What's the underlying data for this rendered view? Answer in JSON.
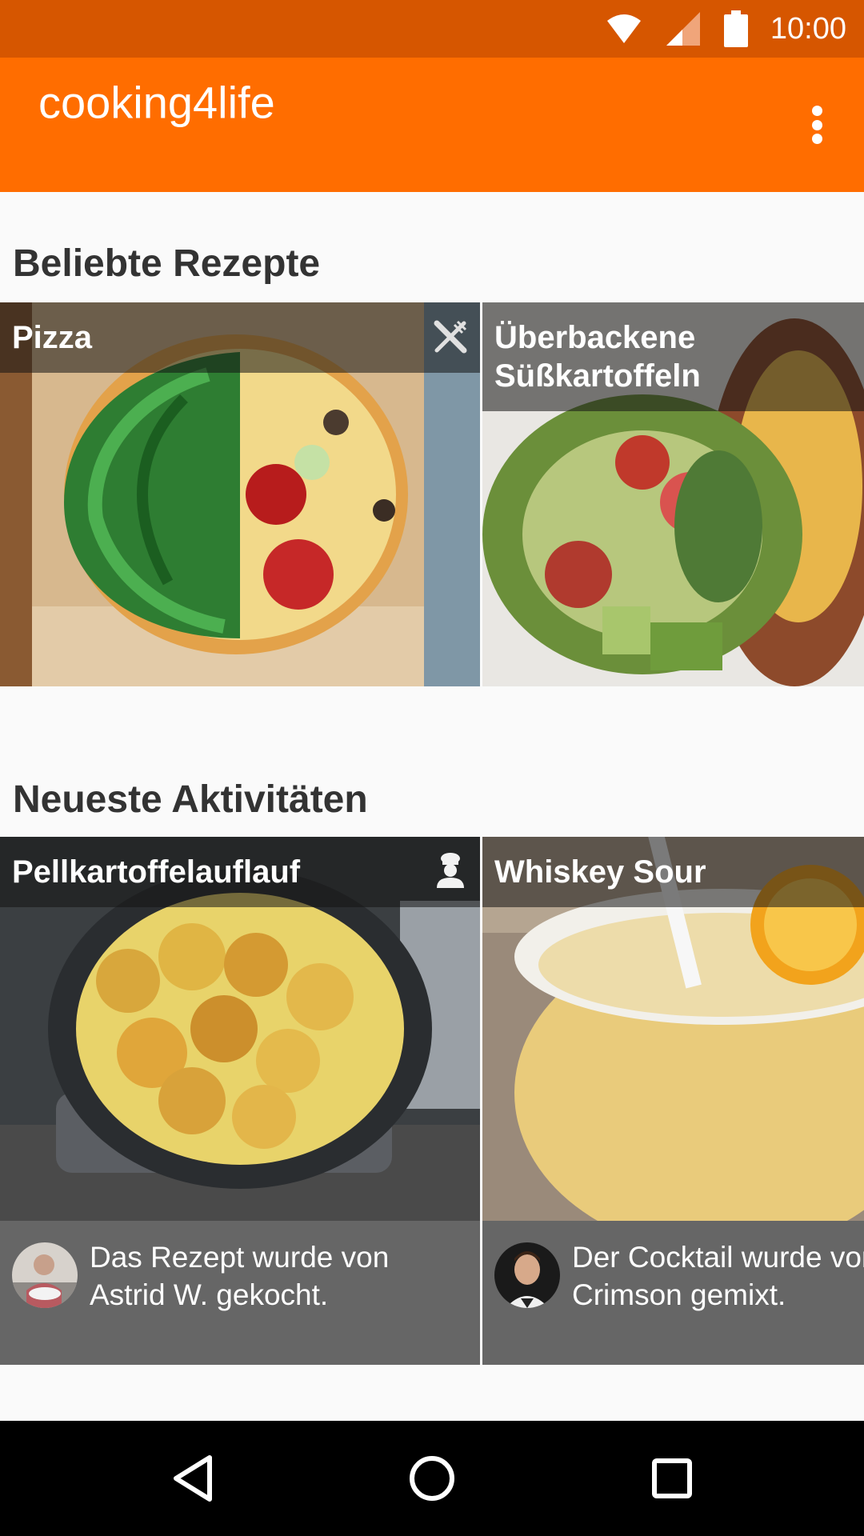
{
  "status_bar": {
    "time": "10:00",
    "icons": [
      "wifi-icon",
      "signal-icon",
      "battery-icon"
    ]
  },
  "app_bar": {
    "title": "cooking4life",
    "menu_icon": "more-vert-icon"
  },
  "sections": {
    "popular": {
      "title": "Beliebte Rezepte",
      "cards": [
        {
          "title": "Pizza",
          "badge_icon": "cutlery-icon"
        },
        {
          "title": "Überbackene Süßkartoffeln"
        }
      ]
    },
    "recent": {
      "title": "Neueste Aktivitäten",
      "cards": [
        {
          "title": "Pellkartoffelauflauf",
          "badge_icon": "chef-icon",
          "activity": "Das Rezept wurde von Astrid W. gekocht."
        },
        {
          "title": "Whiskey Sour",
          "activity": "Der Cocktail wurde von Crimson gemixt."
        }
      ]
    }
  },
  "nav_bar": {
    "icons": [
      "back-icon",
      "home-icon",
      "recents-icon"
    ]
  },
  "colors": {
    "status_bar": "#d65600",
    "app_bar": "#ff6d00",
    "nav_bar": "#000000",
    "footer": "#666666"
  }
}
